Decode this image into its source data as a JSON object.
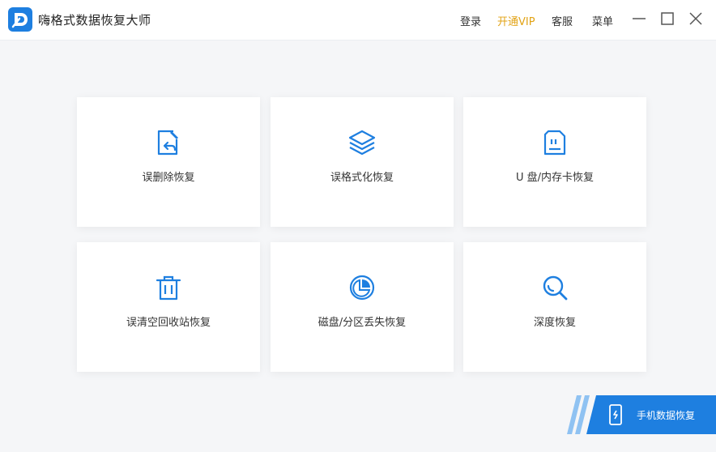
{
  "header": {
    "app_title": "嗨格式数据恢复大师",
    "login": "登录",
    "vip": "开通VIP",
    "service": "客服",
    "menu": "菜单"
  },
  "cards": [
    {
      "label": "误删除恢复",
      "icon": "file-restore-icon"
    },
    {
      "label": "误格式化恢复",
      "icon": "layers-icon"
    },
    {
      "label": "U 盘/内存卡恢复",
      "icon": "sd-card-icon"
    },
    {
      "label": "误清空回收站恢复",
      "icon": "trash-icon"
    },
    {
      "label": "磁盘/分区丢失恢复",
      "icon": "pie-chart-icon"
    },
    {
      "label": "深度恢复",
      "icon": "magnifier-icon"
    }
  ],
  "mobile": {
    "label": "手机数据恢复",
    "icon": "phone-icon"
  },
  "colors": {
    "accent": "#1e7fe0",
    "vip": "#e2a316",
    "background": "#f5f6f8"
  }
}
